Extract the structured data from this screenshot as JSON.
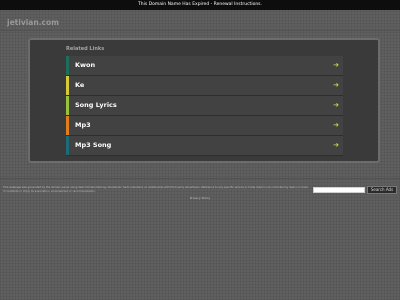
{
  "topbar": {
    "text": "This Domain Name Has Expired - Renewal Instructions."
  },
  "header": {
    "domain": "jetivian.com"
  },
  "related": {
    "title": "Related Links",
    "arrow_icon": "arrow-right-icon",
    "items": [
      {
        "label": "Kwon",
        "color": "#1f6e5c"
      },
      {
        "label": "Ke",
        "color": "#d7c93a"
      },
      {
        "label": "Song Lyrics",
        "color": "#9ac23c"
      },
      {
        "label": "Mp3",
        "color": "#e07d1c"
      },
      {
        "label": "Mp3 Song",
        "color": "#1d6b78"
      }
    ]
  },
  "footer": {
    "disclaimer": "This webpage was generated by the domain owner using Sedo Domain Parking. Disclaimer: Sedo maintains no relationship with third party advertisers. Reference to any specific service or trade mark is not controlled by Sedo nor does it constitute or imply its association, endorsement or recommendation.",
    "privacy": "Privacy Policy",
    "search_button": "Search Ads"
  }
}
